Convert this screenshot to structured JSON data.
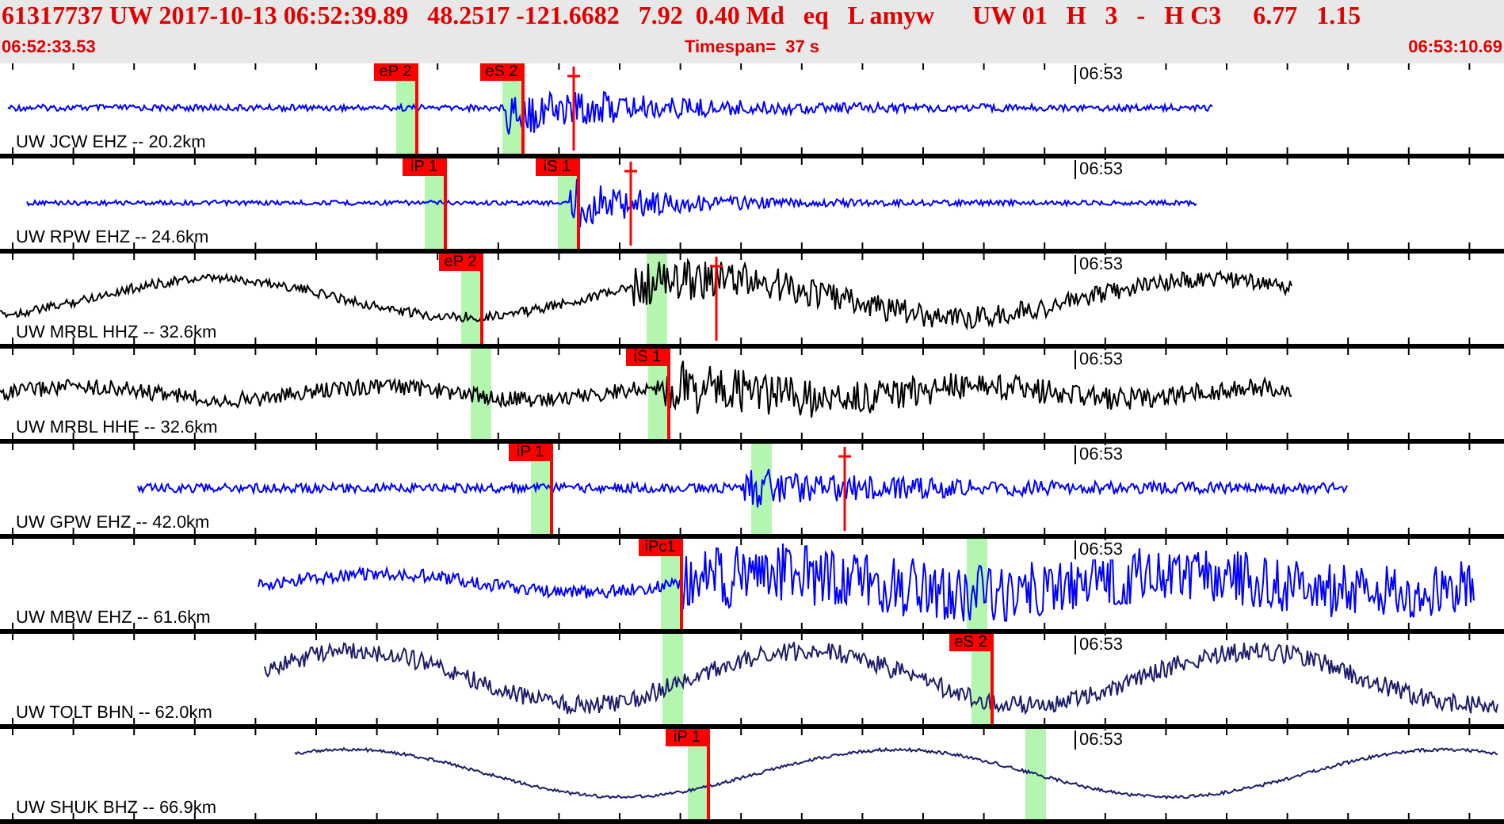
{
  "header": {
    "summary": "61317737 UW 2017-10-13 06:52:39.89   48.2517 -121.6682   7.92  0.40 Md   eq   L amyw      UW 01   H   3   -   H C3     6.77   1.15",
    "start_time": "06:52:33.53",
    "timespan": "Timespan=  37 s",
    "end_time": "06:53:10.69"
  },
  "traces": [
    {
      "station": "UW JCW EHZ -- 20.2km",
      "minute_label": "06:53",
      "color": "#0000ff",
      "picks": [
        {
          "label": "eP 2"
        },
        {
          "label": "eS 2"
        }
      ]
    },
    {
      "station": "UW RPW EHZ -- 24.6km",
      "minute_label": "06:53",
      "color": "#0000ff",
      "picks": [
        {
          "label": "iP 1"
        },
        {
          "label": "iS 1"
        }
      ]
    },
    {
      "station": "UW MRBL HHZ -- 32.6km",
      "minute_label": "06:53",
      "color": "#000000",
      "picks": [
        {
          "label": "eP 2"
        }
      ]
    },
    {
      "station": "UW MRBL HHE -- 32.6km",
      "minute_label": "06:53",
      "color": "#000000",
      "picks": [
        {
          "label": "iS 1"
        }
      ]
    },
    {
      "station": "UW GPW EHZ -- 42.0km",
      "minute_label": "06:53",
      "color": "#0000ff",
      "picks": [
        {
          "label": "iP 1"
        }
      ]
    },
    {
      "station": "UW MBW EHZ -- 61.6km",
      "minute_label": "06:53",
      "color": "#0000ff",
      "picks": [
        {
          "label": "iPc1"
        }
      ]
    },
    {
      "station": "UW TOLT BHN -- 62.0km",
      "minute_label": "06:53",
      "color": "#1c1c6a",
      "picks": [
        {
          "label": "eS 2"
        }
      ]
    },
    {
      "station": "UW SHUK BHZ -- 66.9km",
      "minute_label": "06:53",
      "color": "#1c1c6a",
      "picks": [
        {
          "label": "iP 1"
        }
      ]
    }
  ]
}
